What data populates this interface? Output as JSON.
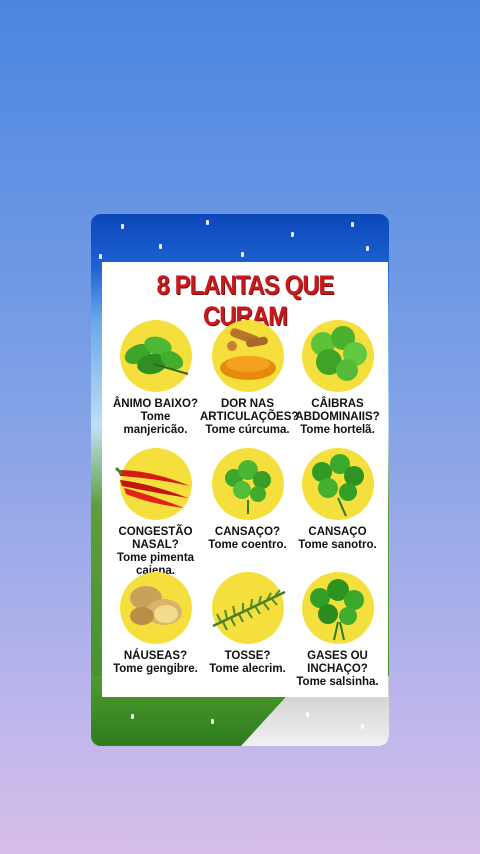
{
  "poster": {
    "title": "8 PLANTAS QUE CURAM",
    "items": [
      {
        "line1": "ÂNIMO BAIXO?",
        "line2": "Tome",
        "line3": "manjericão.",
        "icon": "basil-icon"
      },
      {
        "line1": "DOR NAS",
        "line2": "ARTICULAÇÕES?",
        "line3": "Tome cúrcuma.",
        "icon": "turmeric-icon"
      },
      {
        "line1": "CÂIBRAS",
        "line2": "ABDOMINAIIS?",
        "line3": "Tome hortelã.",
        "icon": "mint-icon"
      },
      {
        "line1": "CONGESTÃO",
        "line2": "NASAL?",
        "line3": "Tome pimenta",
        "line4": "caiena.",
        "icon": "cayenne-pepper-icon"
      },
      {
        "line1": "CANSAÇO?",
        "line2": "Tome coentro.",
        "icon": "cilantro-icon"
      },
      {
        "line1": "CANSAÇO",
        "line2": "Tome sanotro.",
        "icon": "parsley-icon"
      },
      {
        "line1": "NÁUSEAS?",
        "line2": "Tome gengibre.",
        "icon": "ginger-icon"
      },
      {
        "line1": "TOSSE?",
        "line2": "Tome alecrim.",
        "icon": "rosemary-icon"
      },
      {
        "line1": "GASES OU",
        "line2": "INCHAÇO?",
        "line3": "Tome salsinha.",
        "icon": "parsley-bunch-icon"
      }
    ]
  },
  "colors": {
    "title": "#c8191d",
    "circle": "#f5df3c",
    "leaf": "#3fa52a"
  }
}
